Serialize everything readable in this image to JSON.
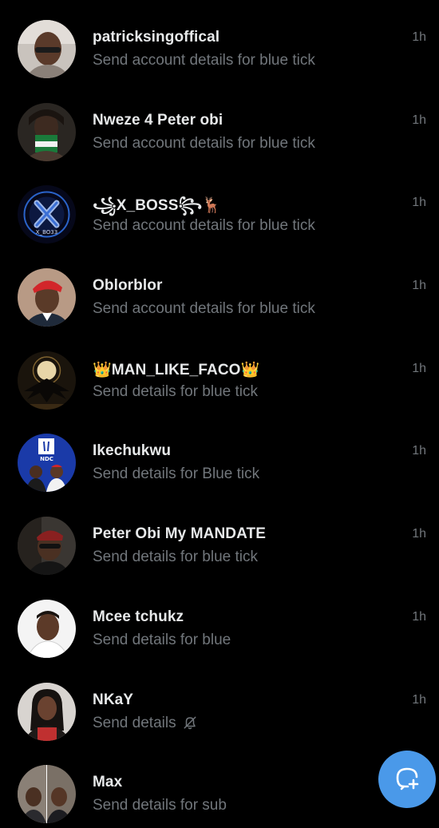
{
  "accent_color": "#4a99e9",
  "secondary_text_color": "#71767b",
  "conversations": [
    {
      "name": "patricksingoffical",
      "preview": "Send account details for blue tick",
      "time": "1h"
    },
    {
      "name": "Nweze 4 Peter obi",
      "preview": "Send account details for blue tick",
      "time": "1h"
    },
    {
      "name": "꧁X_BOSS꧂🦌",
      "preview": "Send account details for blue tick",
      "time": "1h"
    },
    {
      "name": "Oblorblor",
      "preview": "Send account details for blue tick",
      "time": "1h"
    },
    {
      "name": "👑MAN_LIKE_FACO👑",
      "preview": "Send details for blue tick",
      "time": "1h"
    },
    {
      "name": "Ikechukwu",
      "preview": "Send details for Blue tick",
      "time": "1h"
    },
    {
      "name": "Peter Obi My MANDATE",
      "preview": "Send details for blue tick",
      "time": "1h"
    },
    {
      "name": "Mcee tchukz",
      "preview": "Send details for blue",
      "time": "1h"
    },
    {
      "name": "NKaY",
      "preview": "Send details",
      "time": "1h",
      "muted_icon": "bell-off-icon"
    },
    {
      "name": "Max",
      "preview": "Send details for sub",
      "time": ""
    }
  ],
  "avatar_3_text": "X_BO33",
  "avatar_6_text": "NDC",
  "fab_icon": "new-message-icon"
}
